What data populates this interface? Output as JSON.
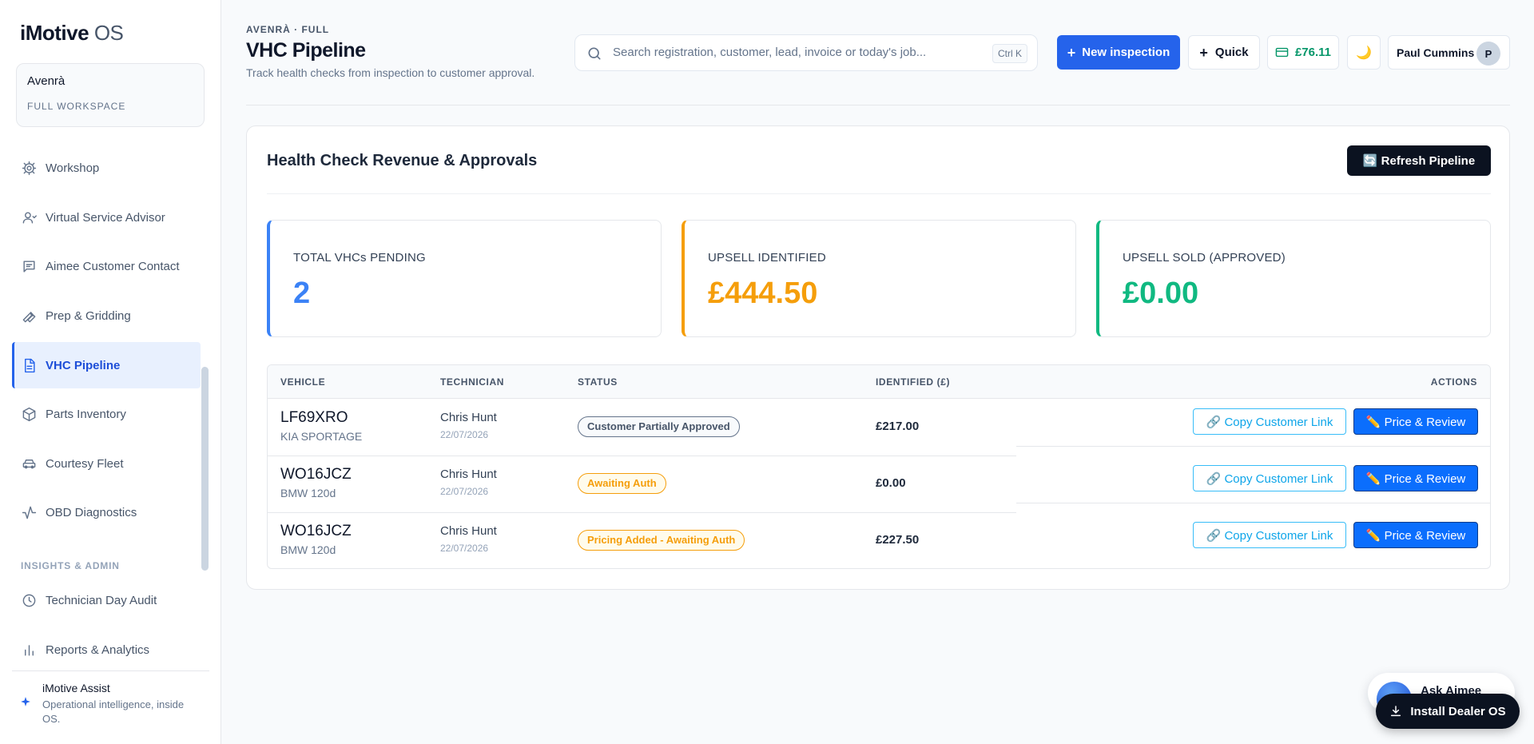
{
  "app": {
    "logo_bold": "iMotive",
    "logo_light": "OS"
  },
  "workspace": {
    "name": "Avenrà",
    "subtitle": "FULL WORKSPACE"
  },
  "sidebar": {
    "items": [
      {
        "label": "Workshop",
        "icon": "gear-icon"
      },
      {
        "label": "Virtual Service Advisor",
        "icon": "user-icon"
      },
      {
        "label": "Aimee Customer Contact",
        "icon": "message-icon"
      },
      {
        "label": "Prep & Gridding",
        "icon": "wrench-icon"
      },
      {
        "label": "VHC Pipeline",
        "icon": "document-icon",
        "active": true
      },
      {
        "label": "Parts Inventory",
        "icon": "box-icon"
      },
      {
        "label": "Courtesy Fleet",
        "icon": "car-icon"
      },
      {
        "label": "OBD Diagnostics",
        "icon": "activity-icon"
      }
    ],
    "section_label": "INSIGHTS & ADMIN",
    "admin_items": [
      {
        "label": "Technician Day Audit",
        "icon": "clock-icon"
      },
      {
        "label": "Reports & Analytics",
        "icon": "bar-chart-icon"
      }
    ],
    "assist": {
      "title": "iMotive Assist",
      "subtitle": "Operational intelligence, inside OS."
    }
  },
  "header": {
    "breadcrumb": "AVENRÀ · FULL",
    "title": "VHC Pipeline",
    "subtitle": "Track health checks from inspection to customer approval.",
    "search_placeholder": "Search registration, customer, lead, invoice or today's job...",
    "search_shortcut": "Ctrl K",
    "new_inspection": "New inspection",
    "quick": "Quick",
    "balance": "£76.11",
    "user_name": "Paul Cummins",
    "user_initial": "P"
  },
  "panel": {
    "title": "Health Check Revenue & Approvals",
    "refresh_label": "🔄 Refresh Pipeline",
    "kpis": [
      {
        "label": "TOTAL VHCs PENDING",
        "value": "2",
        "color": "#3b82f6"
      },
      {
        "label": "UPSELL IDENTIFIED",
        "value": "£444.50",
        "color": "#f59e0b"
      },
      {
        "label": "UPSELL SOLD (APPROVED)",
        "value": "£0.00",
        "color": "#10b981"
      }
    ],
    "table": {
      "columns": [
        "VEHICLE",
        "TECHNICIAN",
        "STATUS",
        "IDENTIFIED (£)",
        "ACTIONS"
      ],
      "rows": [
        {
          "reg": "LF69XRO",
          "model": "KIA SPORTAGE",
          "tech": "Chris Hunt",
          "date": "22/07/2026",
          "status": "Customer Partially Approved",
          "status_tone": "grey",
          "amount": "£217.00"
        },
        {
          "reg": "WO16JCZ",
          "model": "BMW 120d",
          "tech": "Chris Hunt",
          "date": "22/07/2026",
          "status": "Awaiting Auth",
          "status_tone": "amber",
          "amount": "£0.00"
        },
        {
          "reg": "WO16JCZ",
          "model": "BMW 120d",
          "tech": "Chris Hunt",
          "date": "22/07/2026",
          "status": "Pricing Added - Awaiting Auth",
          "status_tone": "amber",
          "amount": "£227.50"
        }
      ],
      "copy_label": "🔗 Copy Customer Link",
      "price_label": "✏️ Price & Review"
    }
  },
  "floating": {
    "ask_label": "Ask Aimee",
    "install_label": "Install Dealer OS"
  }
}
